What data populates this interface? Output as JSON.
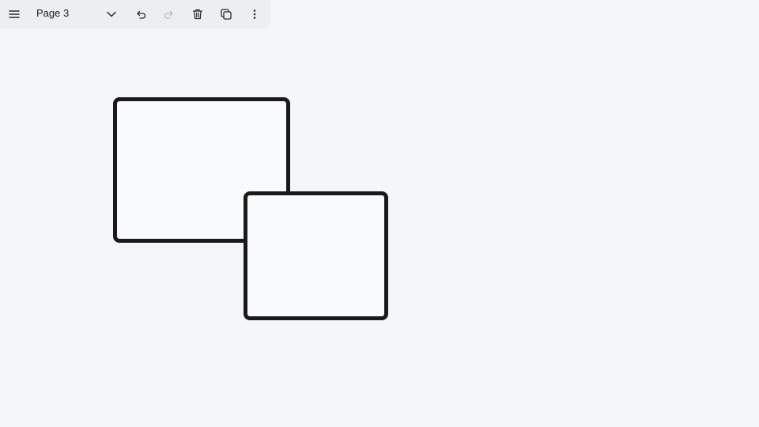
{
  "toolbar": {
    "page_name": "Page 3",
    "icons": {
      "menu": "hamburger-menu-icon",
      "page_dropdown": "chevron-down-icon",
      "undo": "undo-icon",
      "redo": "redo-icon",
      "delete": "trash-icon",
      "duplicate": "duplicate-icon",
      "more": "more-vertical-icon"
    }
  },
  "canvas": {
    "background": "#f5f6fa",
    "shape_stroke": "#1a1a1a",
    "shape_fill": "#f9fafc"
  }
}
